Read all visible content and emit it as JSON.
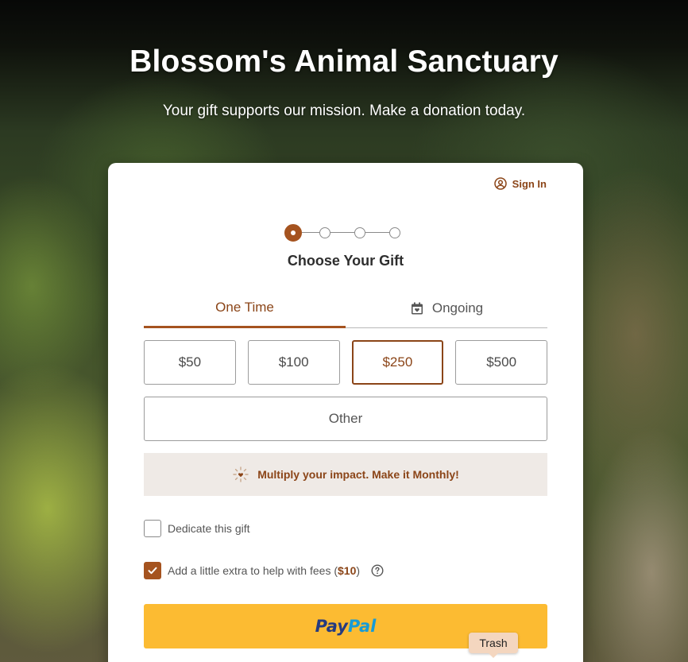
{
  "header": {
    "title": "Blossom's Animal Sanctuary",
    "subtitle": "Your gift supports our mission. Make a donation today."
  },
  "signin": {
    "label": "Sign In",
    "icon": "user-circle-icon"
  },
  "stepper": {
    "current_step": 1,
    "total_steps": 4,
    "title": "Choose Your Gift"
  },
  "tabs": [
    {
      "label": "One Time",
      "active": true
    },
    {
      "label": "Ongoing",
      "active": false,
      "icon": "calendar-heart-icon"
    }
  ],
  "amounts": [
    {
      "label": "$50",
      "selected": false
    },
    {
      "label": "$100",
      "selected": false
    },
    {
      "label": "$250",
      "selected": true
    },
    {
      "label": "$500",
      "selected": false
    }
  ],
  "other_label": "Other",
  "promo": {
    "text": "Multiply your impact. Make it Monthly!",
    "icon": "sparkle-heart-icon"
  },
  "dedicate": {
    "label": "Dedicate this gift",
    "checked": false
  },
  "fees": {
    "label_prefix": "Add a little extra to help with fees (",
    "amount": "$10",
    "label_suffix": ")",
    "checked": true
  },
  "paypal": {
    "part1": "Pay",
    "part2": "Pal"
  },
  "tooltip": {
    "label": "Trash"
  },
  "colors": {
    "accent": "#a5531f",
    "accent_text": "#8b4518",
    "paypal": "#fcbb32",
    "promo_bg": "#efeae6"
  }
}
